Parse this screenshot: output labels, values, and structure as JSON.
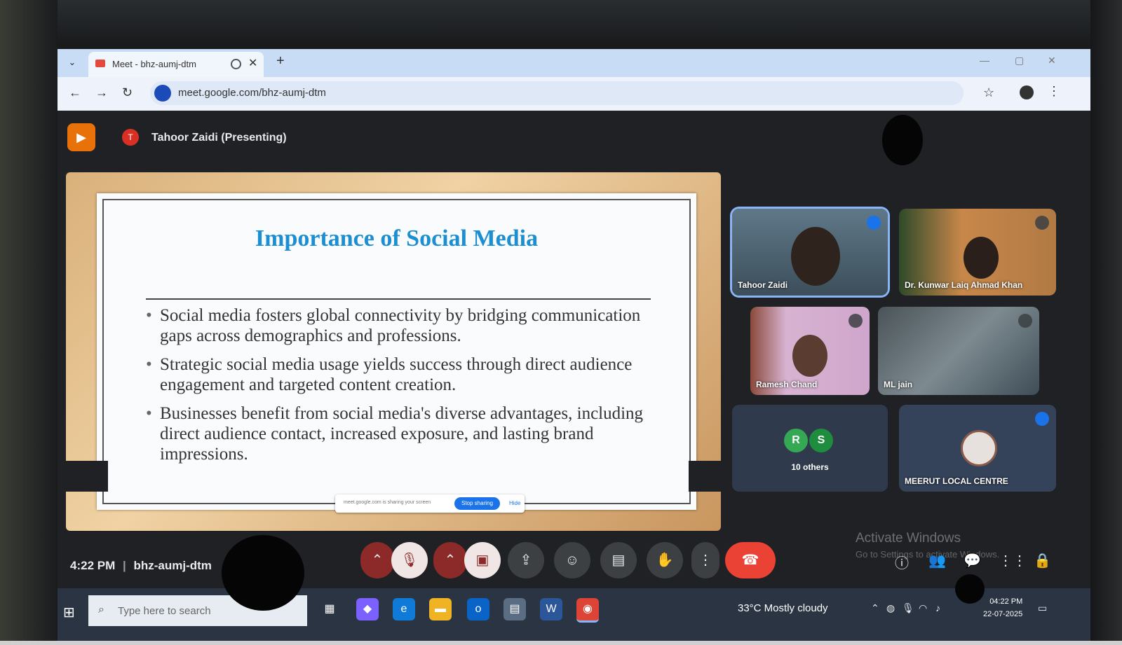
{
  "browser": {
    "tab_title": "Meet - bhz-aumj-dtm",
    "url": "meet.google.com/bhz-aumj-dtm"
  },
  "meet": {
    "presenter_initial": "T",
    "presenter_label": "Tahoor Zaidi (Presenting)",
    "time": "4:22 PM",
    "separator": "|",
    "meeting_code": "bhz-aumj-dtm"
  },
  "slide": {
    "title": "Importance of Social Media",
    "bullets": [
      "Social media fosters global connectivity by bridging communication gaps across demographics and professions.",
      "Strategic social media usage yields success through direct audience engagement and targeted content creation.",
      "Businesses benefit from social media's diverse advantages, including direct audience contact, increased exposure, and lasting brand impressions."
    ]
  },
  "share_bar": {
    "text": "meet.google.com is sharing your screen",
    "stop_label": "Stop sharing",
    "hide_label": "Hide"
  },
  "participants": [
    {
      "name": "Tahoor Zaidi"
    },
    {
      "name": "Dr. Kunwar Laiq Ahmad Khan"
    },
    {
      "name": "Ramesh Chand"
    },
    {
      "name": "ML jain"
    },
    {
      "name": "MEERUT LOCAL CENTRE"
    }
  ],
  "others": {
    "avatar1": "R",
    "avatar2": "S",
    "label": "10 others"
  },
  "windows": {
    "activate_title": "Activate Windows",
    "activate_sub": "Go to Settings to activate Windows.",
    "search_placeholder": "Type here to search",
    "weather": "33°C  Mostly cloudy",
    "clock_time": "04:22 PM",
    "clock_date": "22-07-2025"
  },
  "colors": {
    "slide_title": "#1b8fd1",
    "end_call": "#ea4335",
    "stop_sharing": "#1a73e8"
  }
}
